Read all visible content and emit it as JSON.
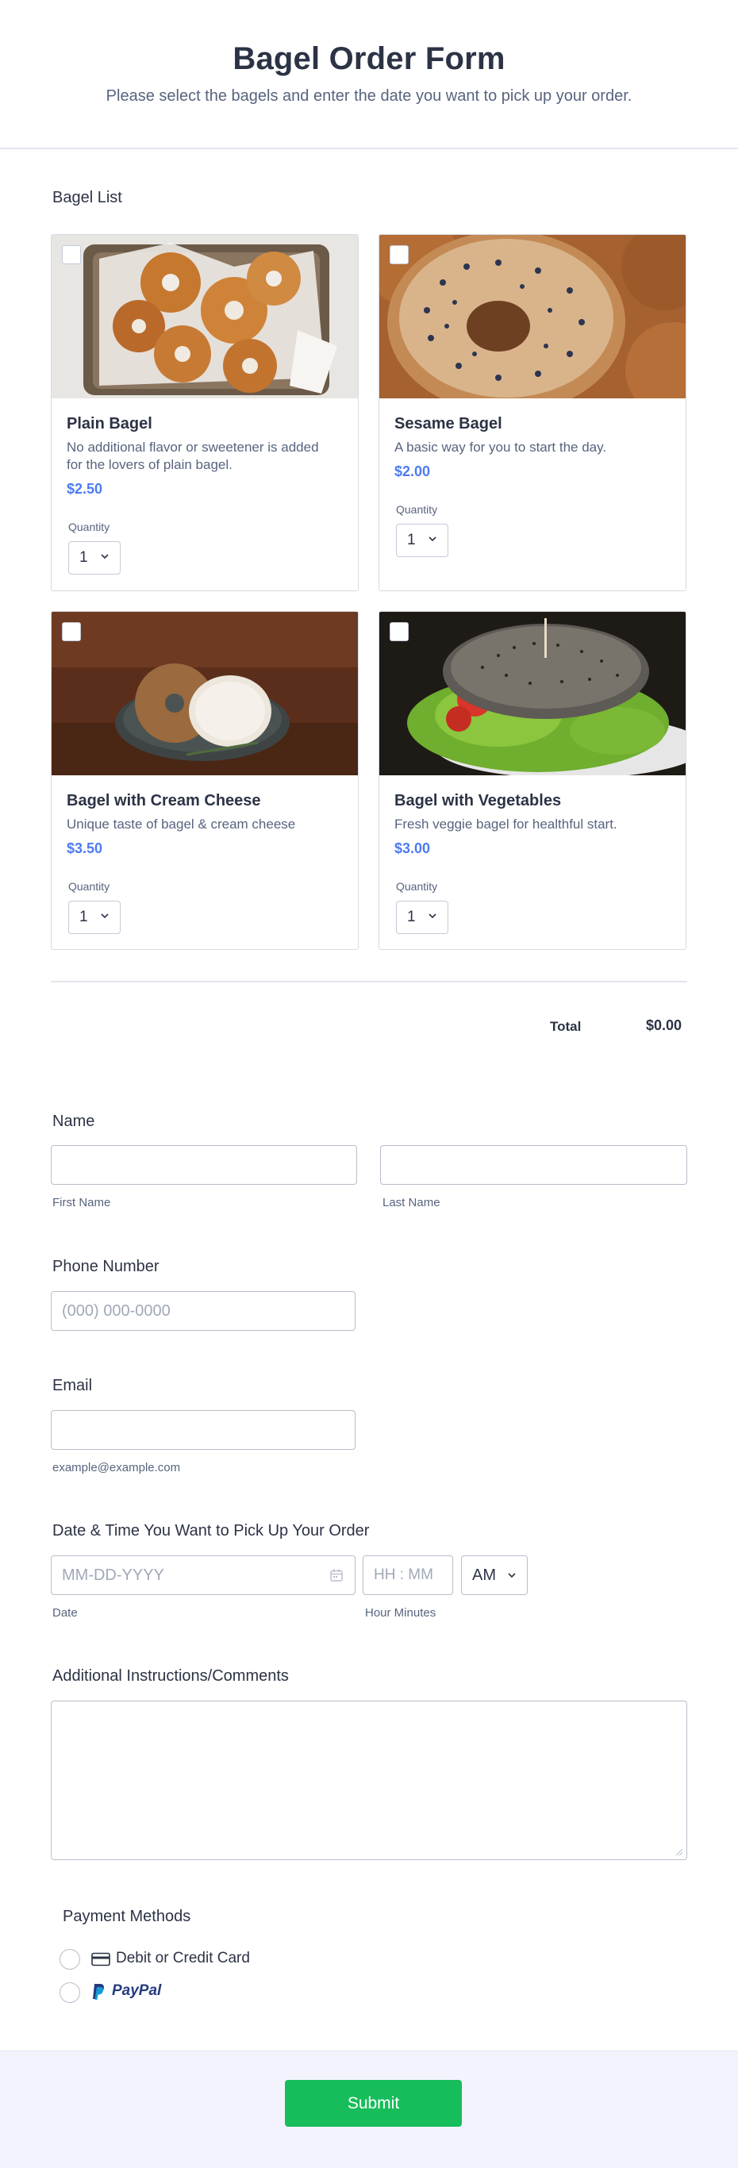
{
  "header": {
    "title": "Bagel Order Form",
    "subtitle": "Please select the bagels and enter the date you want to pick up your order."
  },
  "bagel_list": {
    "label": "Bagel List",
    "items": [
      {
        "name": "Plain Bagel",
        "description": "No additional flavor or sweetener is added for the lovers of plain bagel.",
        "price": "$2.50",
        "quantity_label": "Quantity",
        "quantity": "1",
        "checked": false,
        "image_icon": "bagel-basket-photo"
      },
      {
        "name": "Sesame Bagel",
        "description": "A basic way for you to start the day.",
        "price": "$2.00",
        "quantity_label": "Quantity",
        "quantity": "1",
        "checked": false,
        "image_icon": "sesame-bagel-photo"
      },
      {
        "name": "Bagel with Cream Cheese",
        "description": "Unique taste of bagel & cream cheese",
        "price": "$3.50",
        "quantity_label": "Quantity",
        "quantity": "1",
        "checked": false,
        "image_icon": "cream-cheese-bagel-photo"
      },
      {
        "name": "Bagel with Vegetables",
        "description": "Fresh veggie bagel for healthful start.",
        "price": "$3.00",
        "quantity_label": "Quantity",
        "quantity": "1",
        "checked": false,
        "image_icon": "veggie-bagel-photo"
      }
    ],
    "total_label": "Total",
    "total_value": "$0.00"
  },
  "name": {
    "label": "Name",
    "first_value": "",
    "last_value": "",
    "first_sublabel": "First Name",
    "last_sublabel": "Last Name"
  },
  "phone": {
    "label": "Phone Number",
    "placeholder": "(000) 000-0000"
  },
  "email": {
    "label": "Email",
    "value": "",
    "sublabel": "example@example.com"
  },
  "pickup": {
    "label": "Date & Time You Want to Pick Up Your Order",
    "date_placeholder": "MM-DD-YYYY",
    "time_placeholder": "HH : MM",
    "ampm_value": "AM",
    "date_sublabel": "Date",
    "time_sublabel": "Hour Minutes"
  },
  "comments": {
    "label": "Additional Instructions/Comments",
    "value": ""
  },
  "payment": {
    "label": "Payment Methods",
    "options": [
      {
        "label": "Debit or Credit Card",
        "icon": "credit-card-icon",
        "selected": false
      },
      {
        "label": "PayPal",
        "icon": "paypal-logo",
        "selected": false
      }
    ]
  },
  "footer": {
    "submit_label": "Submit",
    "accent_color": "#18bd5b"
  },
  "colors": {
    "price": "#4d7bf3",
    "text": "#2c3345",
    "muted": "#57647e"
  }
}
